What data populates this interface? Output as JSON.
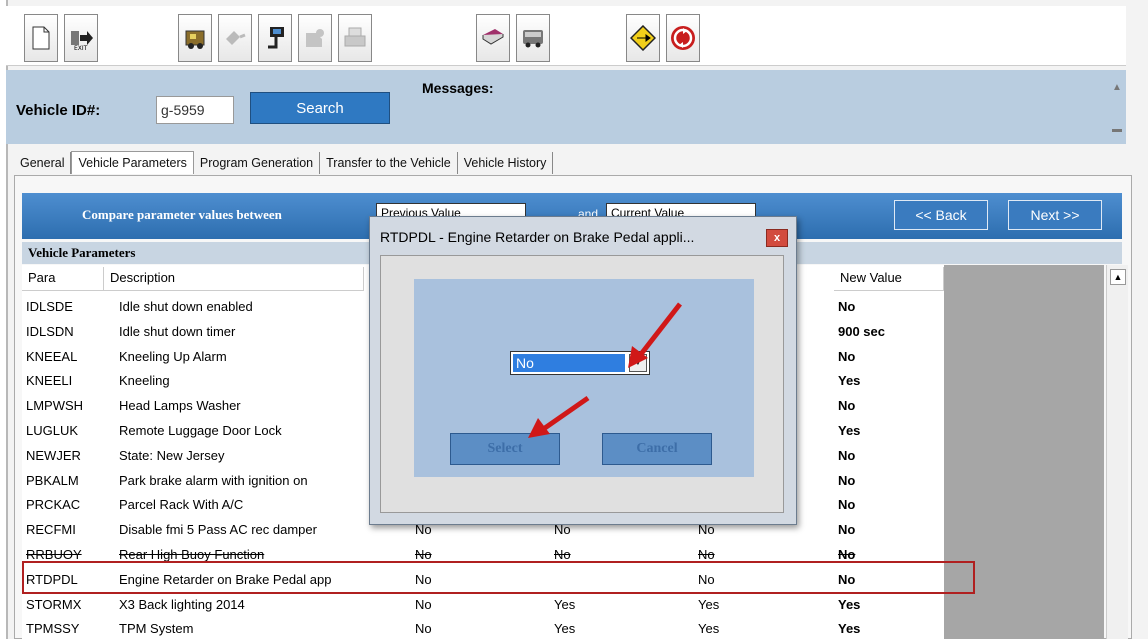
{
  "toolbar": {
    "buttons": [
      {
        "name": "new-document-icon"
      },
      {
        "name": "exit-icon",
        "label": "EXIT"
      },
      {
        "name": "vehicle-load-icon"
      },
      {
        "name": "plug-icon"
      },
      {
        "name": "connect-cable-icon"
      },
      {
        "name": "unplug-icon"
      },
      {
        "name": "printer-icon"
      },
      {
        "name": "book-icon"
      },
      {
        "name": "bus-icon"
      },
      {
        "name": "direction-sign-icon"
      },
      {
        "name": "refresh-icon"
      }
    ]
  },
  "idbar": {
    "vehicle_id_label": "Vehicle ID#:",
    "vehicle_id_value": "g-5959",
    "search_label": "Search",
    "messages_label": "Messages:"
  },
  "tabs": [
    {
      "label": "General",
      "active": false
    },
    {
      "label": "Vehicle Parameters",
      "active": true
    },
    {
      "label": "Program Generation",
      "active": false
    },
    {
      "label": "Transfer to the Vehicle",
      "active": false
    },
    {
      "label": "Vehicle History",
      "active": false
    }
  ],
  "compare": {
    "label": "Compare parameter values between",
    "select1": "Previous Value",
    "and": "and",
    "select2": "Current Value",
    "back_label": "<< Back",
    "next_label": "Next >>"
  },
  "section_title": "Vehicle Parameters",
  "columns": {
    "para": "Para",
    "description": "Description",
    "new_value": "New Value"
  },
  "rows": [
    {
      "code": "IDLSDE",
      "desc": "Idle shut down enabled",
      "v1": "",
      "v2": "",
      "v3": "",
      "new": "No"
    },
    {
      "code": "IDLSDN",
      "desc": "Idle shut down timer",
      "v1": "",
      "v2": "",
      "v3": "",
      "new": "900 sec"
    },
    {
      "code": "KNEEAL",
      "desc": "Kneeling Up Alarm",
      "v1": "",
      "v2": "",
      "v3": "",
      "new": "No"
    },
    {
      "code": "KNEELI",
      "desc": "Kneeling",
      "v1": "",
      "v2": "",
      "v3": "",
      "new": "Yes"
    },
    {
      "code": "LMPWSH",
      "desc": "Head Lamps Washer",
      "v1": "",
      "v2": "",
      "v3": "",
      "new": "No"
    },
    {
      "code": "LUGLUK",
      "desc": "Remote Luggage Door Lock",
      "v1": "",
      "v2": "",
      "v3": "",
      "new": "Yes"
    },
    {
      "code": "NEWJER",
      "desc": "State: New Jersey",
      "v1": "",
      "v2": "",
      "v3": "",
      "new": "No"
    },
    {
      "code": "PBKALM",
      "desc": "Park brake alarm with ignition on",
      "v1": "",
      "v2": "",
      "v3": "",
      "new": "No"
    },
    {
      "code": "PRCKAC",
      "desc": "Parcel Rack With A/C",
      "v1": "",
      "v2": "",
      "v3": "",
      "new": "No"
    },
    {
      "code": "RECFMI",
      "desc": "Disable fmi 5 Pass AC rec damper",
      "v1": "No",
      "v2": "No",
      "v3": "No",
      "new": "No"
    },
    {
      "code": "RRBUOY",
      "desc": "Rear High Buoy Function",
      "v1": "No",
      "v2": "No",
      "v3": "No",
      "new": "No"
    },
    {
      "code": "RTDPDL",
      "desc": "Engine Retarder on Brake Pedal app",
      "v1": "No",
      "v2": "",
      "v3": "No",
      "new": "No"
    },
    {
      "code": "STORMX",
      "desc": "X3 Back lighting 2014",
      "v1": "No",
      "v2": "Yes",
      "v3": "Yes",
      "new": "Yes"
    },
    {
      "code": "TPMSSY",
      "desc": "TPM System",
      "v1": "No",
      "v2": "Yes",
      "v3": "Yes",
      "new": "Yes"
    }
  ],
  "dialog": {
    "title": "RTDPDL - Engine Retarder on Brake Pedal appli...",
    "close_label": "x",
    "selected_value": "No",
    "select_label": "Select",
    "cancel_label": "Cancel"
  },
  "colors": {
    "accent": "#2f79c2",
    "highlight": "#b02020",
    "arrow": "#d01818"
  }
}
